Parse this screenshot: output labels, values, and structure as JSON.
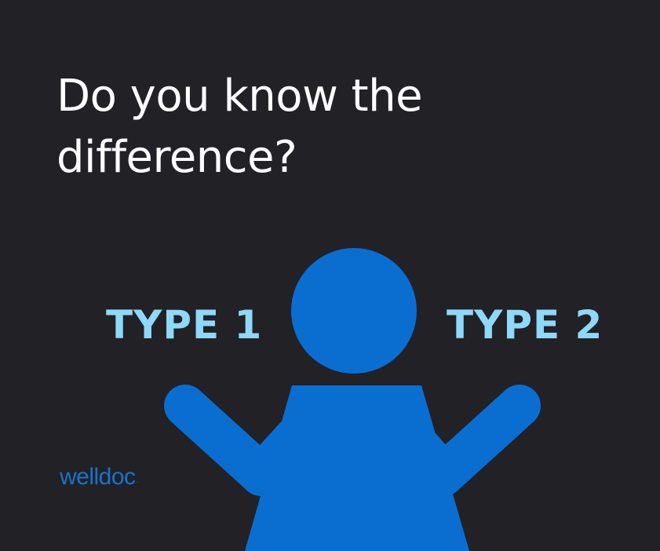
{
  "headline": {
    "line1": "Do you know the",
    "line2": "difference?"
  },
  "labels": {
    "left": "TYPE 1",
    "right": "TYPE 2"
  },
  "brand": {
    "name": "welldoc",
    "mark": "·"
  },
  "icons": {
    "figure": "shrugging-person-icon"
  },
  "colors": {
    "background": "#212126",
    "headline": "#ffffff",
    "label": "#8ed8f8",
    "figure": "#0a6ed1",
    "brand": "#1a73c9"
  }
}
